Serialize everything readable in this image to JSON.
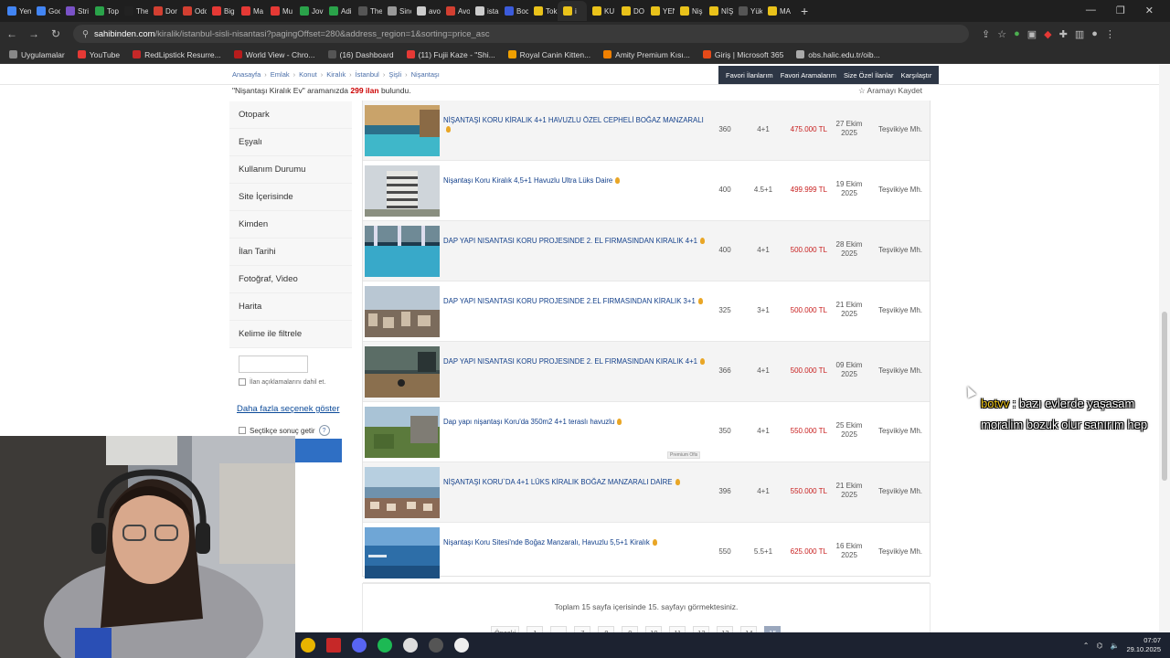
{
  "browser": {
    "tabs": [
      {
        "label": "Yen",
        "color": "#4285f4"
      },
      {
        "label": "Goo",
        "color": "#4285f4"
      },
      {
        "label": "Stri",
        "color": "#7a52c7"
      },
      {
        "label": "Top",
        "color": "#2aa34a"
      },
      {
        "label": "The",
        "color": "#222222"
      },
      {
        "label": "Dor",
        "color": "#d23f31"
      },
      {
        "label": "Odc",
        "color": "#d23f31"
      },
      {
        "label": "Big",
        "color": "#e53935"
      },
      {
        "label": "Ma",
        "color": "#e53935"
      },
      {
        "label": "Mu",
        "color": "#e53935"
      },
      {
        "label": "Jov",
        "color": "#2aa34a"
      },
      {
        "label": "Adi",
        "color": "#2aa34a"
      },
      {
        "label": "The",
        "color": "#555555"
      },
      {
        "label": "Sinc",
        "color": "#999999"
      },
      {
        "label": "avo",
        "color": "#cccccc"
      },
      {
        "label": "Avo",
        "color": "#d23f31"
      },
      {
        "label": "ista",
        "color": "#cccccc"
      },
      {
        "label": "Boc",
        "color": "#3b5bdb"
      },
      {
        "label": "Tok",
        "color": "#e9c21a"
      },
      {
        "label": "i",
        "color": "#e9c21a"
      },
      {
        "label": "KU",
        "color": "#e9c21a"
      },
      {
        "label": "DO",
        "color": "#e9c21a"
      },
      {
        "label": "YEN",
        "color": "#e9c21a"
      },
      {
        "label": "Niş",
        "color": "#e9c21a"
      },
      {
        "label": "NİŞ",
        "color": "#e9c21a"
      },
      {
        "label": "Yük",
        "color": "#555555"
      },
      {
        "label": "MA",
        "color": "#e9c21a"
      }
    ],
    "new_tab": "+",
    "url_host": "sahibinden.com",
    "url_path": "/kiralik/istanbul-sisli-nisantasi?pagingOffset=280&address_region=1&sorting=price_asc",
    "bookmarks": [
      {
        "label": "Uygulamalar",
        "color": "#888888"
      },
      {
        "label": "YouTube",
        "color": "#e53935"
      },
      {
        "label": "RedLipstick Resurre...",
        "color": "#c62828"
      },
      {
        "label": "World View - Chro...",
        "color": "#b71c1c"
      },
      {
        "label": "(16) Dashboard",
        "color": "#555555"
      },
      {
        "label": "(11) Fujii Kaze - \"Shi...",
        "color": "#e53935"
      },
      {
        "label": "Royal Canin Kitten...",
        "color": "#f0a000"
      },
      {
        "label": "Amity Premium Kısı...",
        "color": "#f08000"
      },
      {
        "label": "Giriş | Microsoft 365",
        "color": "#e64a19"
      },
      {
        "label": "obs.halic.edu.tr/oib...",
        "color": "#aaaaaa"
      }
    ]
  },
  "site": {
    "breadcrumbs": [
      "Anasayfa",
      "Emlak",
      "Konut",
      "Kiralık",
      "İstanbul",
      "Şişli",
      "Nişantaşı"
    ],
    "top_links": [
      "Favori İlanlarım",
      "Favori Aramalarım",
      "Size Özel İlanlar",
      "Karşılaştır"
    ],
    "search_query": "\"Nişantaşı Kiralık Ev\"",
    "search_result_middle": "aramanızda",
    "search_count": "299 ilan",
    "search_result_end": "bulundu.",
    "save_search": "☆ Aramayı Kaydet"
  },
  "sidebar": {
    "items": [
      "Otopark",
      "Eşyalı",
      "Kullanım Durumu",
      "Site İçerisinde",
      "Kimden",
      "İlan Tarihi",
      "Fotoğraf, Video",
      "Harita",
      "Kelime ile filtrele"
    ],
    "keyword_check_label": "İlan açıklamalarını dahil et.",
    "more_options": "Daha fazla seçenek göster",
    "choose_label": "Seçtikçe sonuç getir",
    "help": "?"
  },
  "listings": [
    {
      "title": "NİŞANTAŞI KORU KİRALIK 4+1 HAVUZLU ÖZEL CEPHELİ BOĞAZ MANZARALI",
      "m2": "360",
      "rooms": "4+1",
      "price": "475.000 TL",
      "date_day": "27 Ekim",
      "date_year": "2025",
      "location": "Teşvikiye Mh.",
      "scene": "pool"
    },
    {
      "title": "Nişantaşı Koru Kiralık 4,5+1 Havuzlu Ultra Lüks Daire",
      "m2": "400",
      "rooms": "4.5+1",
      "price": "499.999 TL",
      "date_day": "19 Ekim",
      "date_year": "2025",
      "location": "Teşvikiye Mh.",
      "scene": "tower"
    },
    {
      "title": "DAP YAPI NISANTASI KORU PROJESINDE 2. EL FIRMASINDAN KIRALIK 4+1",
      "m2": "400",
      "rooms": "4+1",
      "price": "500.000 TL",
      "date_day": "28 Ekim",
      "date_year": "2025",
      "location": "Teşvikiye Mh.",
      "scene": "pool2"
    },
    {
      "title": "DAP YAPI NISANTASI KORU PROJESINDE 2.EL FIRMASINDAN KİRALIK 3+1",
      "m2": "325",
      "rooms": "3+1",
      "price": "500.000 TL",
      "date_day": "21 Ekim",
      "date_year": "2025",
      "location": "Teşvikiye Mh.",
      "scene": "city"
    },
    {
      "title": "DAP YAPI NISANTASI KORU PROJESINDE 2. EL FIRMASINDAN KIRALIK 4+1",
      "m2": "366",
      "rooms": "4+1",
      "price": "500.000 TL",
      "date_day": "09 Ekim",
      "date_year": "2025",
      "location": "Teşvikiye Mh.",
      "scene": "terrace"
    },
    {
      "title": "Dap yapı nişantaşı Koru'da 350m2 4+1 teraslı havuzlu",
      "m2": "350",
      "rooms": "4+1",
      "price": "550.000 TL",
      "date_day": "25 Ekim",
      "date_year": "2025",
      "location": "Teşvikiye Mh.",
      "scene": "garden",
      "badge": "Premium Ofis"
    },
    {
      "title": "NİŞANTAŞI KORU`DA 4+1 LÜKS KİRALIK BOĞAZ MANZARALI DAİRE",
      "m2": "396",
      "rooms": "4+1",
      "price": "550.000 TL",
      "date_day": "21 Ekim",
      "date_year": "2025",
      "location": "Teşvikiye Mh.",
      "scene": "bosphorus"
    },
    {
      "title": "Nişantaşı Koru Sitesi'nde Boğaz Manzaralı, Havuzlu 5,5+1 Kiralık",
      "m2": "550",
      "rooms": "5.5+1",
      "price": "625.000 TL",
      "date_day": "16 Ekim",
      "date_year": "2025",
      "location": "Teşvikiye Mh.",
      "scene": "sea"
    }
  ],
  "pager": {
    "summary": "Toplam 15 sayfa içerisinde 15. sayfayı görmektesiniz.",
    "prev": "Önceki",
    "pages": [
      "1",
      "...",
      "7",
      "8",
      "9",
      "10",
      "11",
      "12",
      "13",
      "14",
      "15"
    ],
    "current": "15"
  },
  "chat": {
    "user": "botvv",
    "message": " : bazı evlerde yaşasam moralim bozuk olur sanırım hep"
  },
  "taskbar": {
    "clock_time": "07:07",
    "clock_date": "29.10.2025"
  }
}
